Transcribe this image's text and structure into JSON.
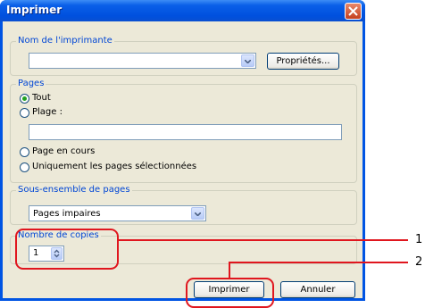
{
  "window": {
    "title": "Imprimer"
  },
  "printer_group": {
    "legend": "Nom de l'imprimante",
    "selected": "",
    "properties_button": "Propriétés..."
  },
  "pages_group": {
    "legend": "Pages",
    "options": [
      {
        "label": "Tout",
        "selected": true
      },
      {
        "label": "Plage :",
        "selected": false
      },
      {
        "label": "Page en cours",
        "selected": false
      },
      {
        "label": "Uniquement les pages sélectionnées",
        "selected": false
      }
    ],
    "range_value": ""
  },
  "subset_group": {
    "legend": "Sous-ensemble de pages",
    "selected": "Pages impaires"
  },
  "copies_group": {
    "legend": "Nombre de copies",
    "value": "1"
  },
  "buttons": {
    "print": "Imprimer",
    "cancel": "Annuler"
  },
  "callouts": [
    "1",
    "2"
  ],
  "colors": {
    "title_bar": "#0054e3",
    "dialog_bg": "#ece9d8",
    "legend_text": "#0046d5",
    "callout": "#e0161e"
  }
}
